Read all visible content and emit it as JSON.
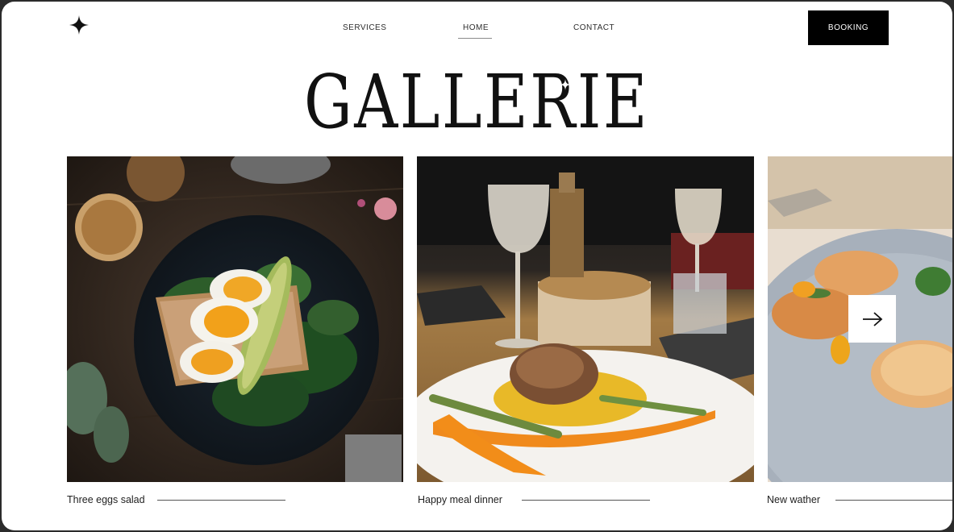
{
  "nav": {
    "items": [
      {
        "label": "SERVICES"
      },
      {
        "label": "HOME"
      },
      {
        "label": "CONTACT"
      }
    ],
    "active": "HOME",
    "booking_label": "BOOKING"
  },
  "hero": {
    "title": "GALLERIE"
  },
  "gallery": {
    "items": [
      {
        "caption": "Three eggs salad",
        "image": "egg-salad-photo"
      },
      {
        "caption": "Happy meal dinner",
        "image": "dinner-plate-photo"
      },
      {
        "caption": "New wather",
        "image": "seafood-plate-photo"
      }
    ],
    "next_icon": "arrow-right-icon"
  },
  "icons": {
    "logo": "four-point-star-icon"
  },
  "colors": {
    "background": "#ffffff",
    "text": "#2d2d2d",
    "button": "#000000",
    "button_text": "#ffffff"
  }
}
